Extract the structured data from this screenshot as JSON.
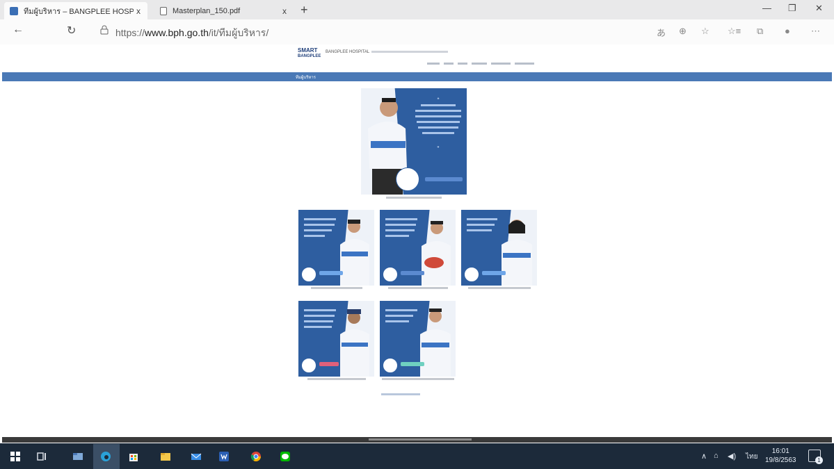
{
  "browser": {
    "tabs": [
      {
        "title": "ทีมผู้บริหาร – BANGPLEE HOSPITA",
        "close": "x"
      },
      {
        "title": "Masterplan_150.pdf",
        "close": "x"
      }
    ],
    "new_tab": "+",
    "window": {
      "minimize": "—",
      "restore": "❐",
      "close": "✕"
    },
    "url_prefix": "https://",
    "url_domain": "www.bph.go.th",
    "url_path": "/it/ทีมผู้บริหาร/",
    "back": "←",
    "refresh": "↻",
    "tools": [
      "あ",
      "⊕",
      "☆",
      "☆≡",
      "⧉",
      "●",
      "⋯"
    ]
  },
  "site": {
    "logo_line1": "SMART",
    "logo_line2": "BANGPLEE",
    "hospital_name": "BANGPLEE HOSPITAL",
    "menubar_label": "ทีมผู้บริหาร"
  },
  "executives": {
    "quote_mark": "❝",
    "quote_close": "❞"
  },
  "colors": {
    "brand_blue": "#4a79b6",
    "card_blue": "#2e5ea0",
    "taskbar": "#1c2a3a"
  },
  "taskbar": {
    "icons": [
      "windows-icon",
      "task-view-icon",
      "explorer-icon",
      "edge-icon",
      "store-icon",
      "folder-icon",
      "mail-icon",
      "word-icon",
      "chrome-icon",
      "line-icon"
    ],
    "tray_chevron": "∧",
    "tray_network": "⌂",
    "tray_volume": "◀)",
    "tray_lang": "ไทย",
    "time": "16:01",
    "date": "19/8/2563",
    "notification": "1"
  }
}
